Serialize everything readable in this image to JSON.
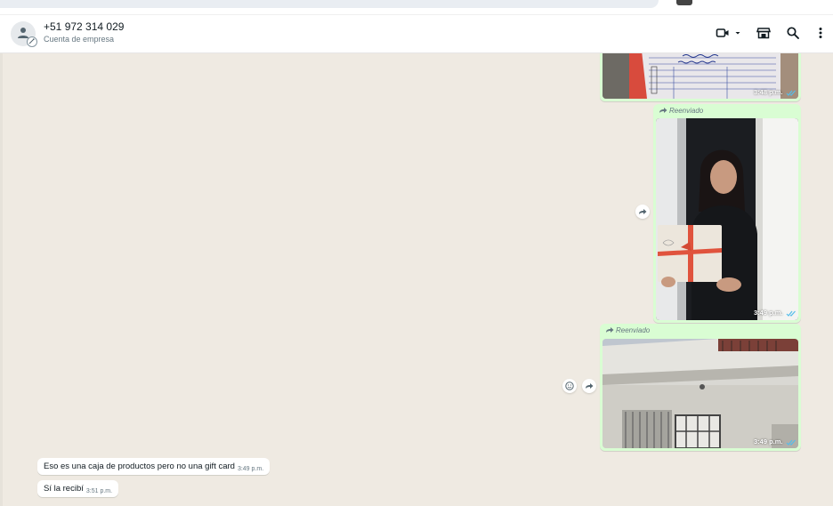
{
  "chat_header": {
    "contact_name": "+51 972 314 029",
    "subtitle": "Cuenta de empresa",
    "icons": [
      "avatar-icon",
      "video-call-icon",
      "chevron-down-icon",
      "catalog-icon",
      "search-icon",
      "menu-icon"
    ]
  },
  "messages": [
    {
      "direction": "outgoing",
      "type": "image",
      "description_icon": "form-document-image",
      "time": "3:48 p.m.",
      "status": "read"
    },
    {
      "direction": "outgoing",
      "type": "image",
      "forwarded_label": "Reenviado",
      "description_icon": "person-holding-box-image",
      "time": "3:49 p.m.",
      "status": "read"
    },
    {
      "direction": "outgoing",
      "type": "image",
      "forwarded_label": "Reenviado",
      "description_icon": "building-facade-image",
      "time": "3:49 p.m.",
      "status": "read"
    },
    {
      "direction": "incoming",
      "type": "text",
      "text": "Eso es una caja de productos pero no una gift card",
      "time": "3:49 p.m."
    },
    {
      "direction": "incoming",
      "type": "text",
      "text": "Sí la recibí",
      "time": "3:51 p.m."
    }
  ],
  "colors": {
    "outgoing_bubble": "#d9fdd3",
    "incoming_bubble": "#ffffff",
    "chat_background": "#efeae2",
    "read_ticks": "#53bdeb"
  }
}
